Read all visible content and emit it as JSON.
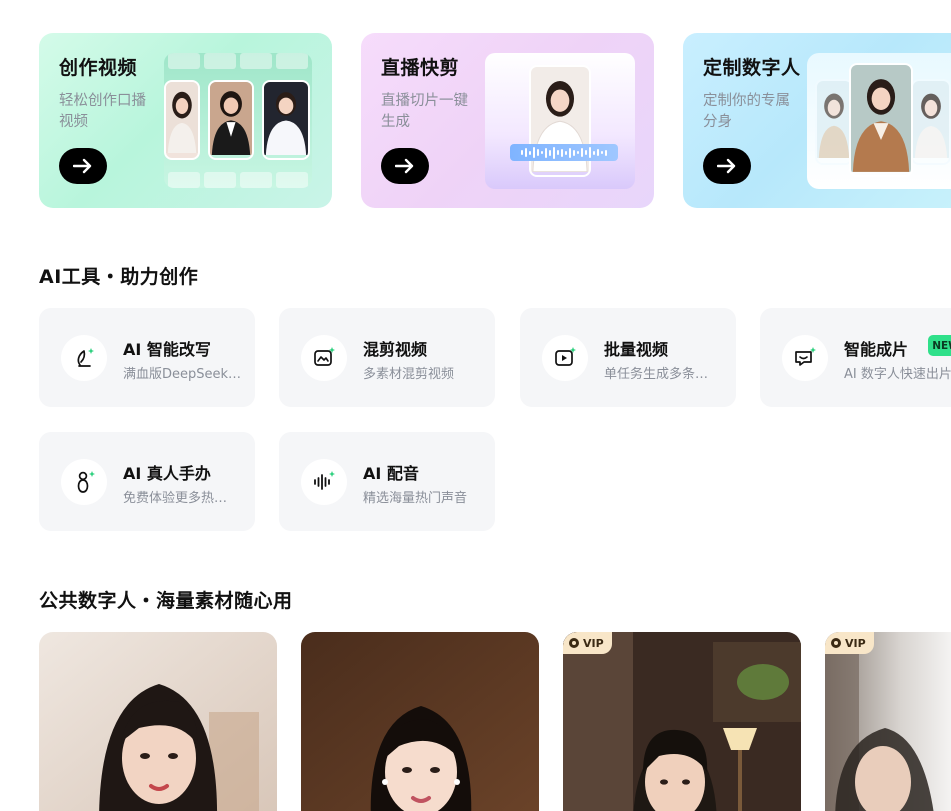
{
  "feature_cards": [
    {
      "title": "创作视频",
      "desc": "轻松创作口播视频",
      "button_icon": "arrow-right-icon"
    },
    {
      "title": "直播快剪",
      "desc": "直播切片一键生成",
      "button_icon": "arrow-right-icon"
    },
    {
      "title": "定制数字人",
      "desc": "定制你的专属分身",
      "button_icon": "arrow-right-icon"
    }
  ],
  "tools_section": {
    "title": "AI工具・助力创作",
    "items": [
      {
        "name": "AI 智能改写",
        "sub": "满血版DeepSeek…",
        "icon": "pen-sparkle-icon"
      },
      {
        "name": "混剪视频",
        "sub": "多素材混剪视频",
        "icon": "image-sparkle-icon"
      },
      {
        "name": "批量视频",
        "sub": "单任务生成多条…",
        "icon": "play-sparkle-icon"
      },
      {
        "name": "智能成片",
        "sub": "AI 数字人快速出片",
        "icon": "chat-sparkle-icon",
        "badge": "NEW"
      },
      {
        "name": "AI 真人手办",
        "sub": "免费体验更多热…",
        "icon": "figure-sparkle-icon"
      },
      {
        "name": "AI 配音",
        "sub": "精选海量热门声音",
        "icon": "waveform-sparkle-icon"
      }
    ]
  },
  "avatars_section": {
    "title": "公共数字人・海量素材随心用",
    "cards": [
      {
        "vip": ""
      },
      {
        "vip": ""
      },
      {
        "vip": "VIP"
      },
      {
        "vip": "VIP"
      }
    ]
  },
  "colors": {
    "card_green": "#c9f6e2",
    "card_pink": "#f2d8f9",
    "card_blue": "#c3ecfc",
    "new_badge": "#2fe08a",
    "vip_badge": "#f8e6c8",
    "tool_bg": "#f5f6f8"
  }
}
